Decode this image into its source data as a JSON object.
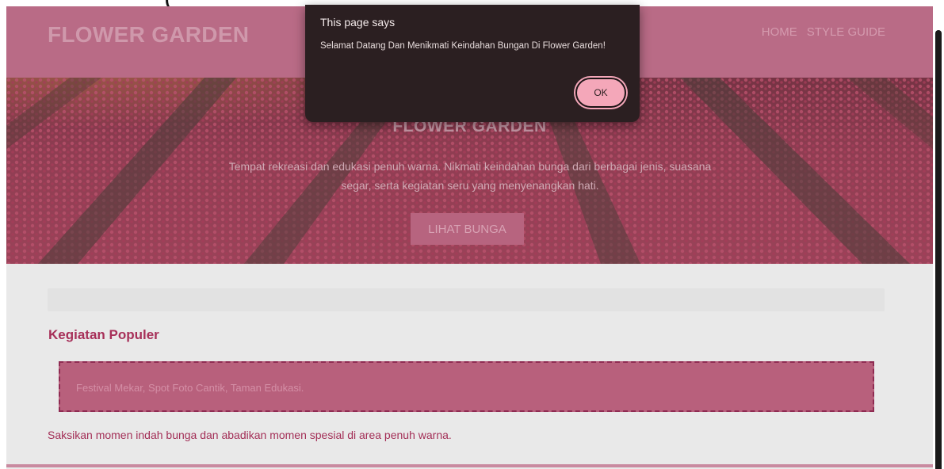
{
  "top_cut_text": "(",
  "navbar": {
    "logo": "FLOWER GARDEN",
    "links": [
      {
        "label": "HOME"
      },
      {
        "label": "STYLE GUIDE"
      }
    ]
  },
  "hero": {
    "title": "FLOWER GARDEN",
    "description": "Tempat rekreasi dan edukasi penuh warna. Nikmati keindahan bunga dari berbagai jenis, suasana segar, serta kegiatan seru yang menyenangkan hati.",
    "button_label": "LIHAT BUNGA"
  },
  "section": {
    "title": "Kegiatan Populer",
    "highlight": "Festival Mekar, Spot Foto Cantik, Taman Edukasi.",
    "body": "Saksikan momen indah bunga dan abadikan momen spesial di area penuh warna."
  },
  "dialog": {
    "title": "This page says",
    "message": "Selamat Datang Dan Menikmati Keindahan Bungan Di Flower Garden!",
    "ok_label": "OK"
  },
  "colors": {
    "navbar": "#b96b86",
    "accent": "#a73059",
    "dialog_bg": "#2b1f21",
    "ok_button": "#f4a7b9"
  }
}
